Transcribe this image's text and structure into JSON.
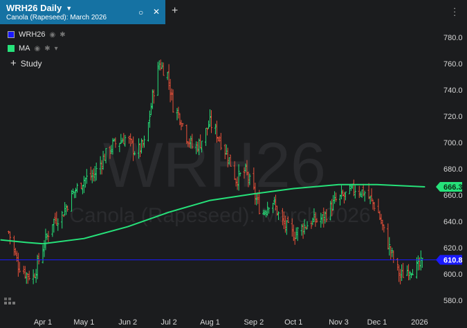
{
  "tab": {
    "title": "WRH26 Daily",
    "subtitle": "Canola (Rapeseed): March 2026"
  },
  "legend": [
    {
      "label": "WRH26",
      "color": "#1a1aff"
    },
    {
      "label": "MA",
      "color": "#26e27a"
    }
  ],
  "study_label": "Study",
  "watermark": {
    "symbol": "WRH26",
    "name": "Canola (Rapeseed): March 2026"
  },
  "colors": {
    "up": "#26e27a",
    "down": "#e8513a",
    "ma": "#26e27a",
    "last": "#1a1aff",
    "accent": "#1572a3"
  },
  "chart_data": {
    "type": "line",
    "x_ticks": [
      "Apr 1",
      "May 1",
      "Jun 2",
      "Jul 2",
      "Aug 1",
      "Sep 2",
      "Oct 1",
      "Nov 3",
      "Dec 1",
      "2026"
    ],
    "ylim": [
      570,
      790
    ],
    "y_ticks": [
      580.0,
      600.0,
      620.0,
      640.0,
      660.0,
      680.0,
      700.0,
      720.0,
      740.0,
      760.0,
      780.0
    ],
    "series": [
      {
        "name": "WRH26",
        "kind": "ohlc",
        "last": 610.8,
        "points": [
          {
            "x": "Mar 7",
            "v": 632
          },
          {
            "x": "Mar 14",
            "v": 607
          },
          {
            "x": "Mar 20",
            "v": 600
          },
          {
            "x": "Mar 25",
            "v": 598
          },
          {
            "x": "Apr 1",
            "v": 620
          },
          {
            "x": "Apr 8",
            "v": 640
          },
          {
            "x": "Apr 15",
            "v": 645
          },
          {
            "x": "Apr 22",
            "v": 660
          },
          {
            "x": "May 1",
            "v": 672
          },
          {
            "x": "May 8",
            "v": 675
          },
          {
            "x": "May 15",
            "v": 688
          },
          {
            "x": "May 22",
            "v": 698
          },
          {
            "x": "Jun 1",
            "v": 704
          },
          {
            "x": "Jun 8",
            "v": 692
          },
          {
            "x": "Jun 15",
            "v": 700
          },
          {
            "x": "Jun 20",
            "v": 735
          },
          {
            "x": "Jun 25",
            "v": 760
          },
          {
            "x": "Jul 1",
            "v": 752
          },
          {
            "x": "Jul 5",
            "v": 728
          },
          {
            "x": "Jul 10",
            "v": 720
          },
          {
            "x": "Jul 15",
            "v": 705
          },
          {
            "x": "Jul 20",
            "v": 695
          },
          {
            "x": "Jul 25",
            "v": 700
          },
          {
            "x": "Aug 1",
            "v": 715
          },
          {
            "x": "Aug 7",
            "v": 705
          },
          {
            "x": "Aug 14",
            "v": 690
          },
          {
            "x": "Aug 20",
            "v": 672
          },
          {
            "x": "Aug 27",
            "v": 678
          },
          {
            "x": "Sep 2",
            "v": 662
          },
          {
            "x": "Sep 8",
            "v": 645
          },
          {
            "x": "Sep 15",
            "v": 658
          },
          {
            "x": "Sep 22",
            "v": 640
          },
          {
            "x": "Oct 1",
            "v": 630
          },
          {
            "x": "Oct 8",
            "v": 636
          },
          {
            "x": "Oct 15",
            "v": 640
          },
          {
            "x": "Oct 22",
            "v": 642
          },
          {
            "x": "Nov 1",
            "v": 656
          },
          {
            "x": "Nov 8",
            "v": 660
          },
          {
            "x": "Nov 15",
            "v": 665
          },
          {
            "x": "Nov 22",
            "v": 662
          },
          {
            "x": "Dec 1",
            "v": 650
          },
          {
            "x": "Dec 6",
            "v": 632
          },
          {
            "x": "Dec 12",
            "v": 614
          },
          {
            "x": "Dec 18",
            "v": 598
          },
          {
            "x": "Dec 24",
            "v": 604
          },
          {
            "x": "Dec 31",
            "v": 605
          },
          {
            "x": "Jan 5",
            "v": 610.8
          }
        ]
      },
      {
        "name": "MA",
        "kind": "line",
        "last": 666.3,
        "points": [
          {
            "x": "Mar 1",
            "v": 626
          },
          {
            "x": "Mar 20",
            "v": 624
          },
          {
            "x": "Apr 1",
            "v": 623
          },
          {
            "x": "May 1",
            "v": 627
          },
          {
            "x": "Jun 2",
            "v": 636
          },
          {
            "x": "Jul 2",
            "v": 647
          },
          {
            "x": "Aug 1",
            "v": 656
          },
          {
            "x": "Sep 2",
            "v": 661
          },
          {
            "x": "Oct 1",
            "v": 665
          },
          {
            "x": "Nov 3",
            "v": 668
          },
          {
            "x": "Dec 1",
            "v": 668
          },
          {
            "x": "Jan 5",
            "v": 666.3
          }
        ]
      }
    ]
  }
}
